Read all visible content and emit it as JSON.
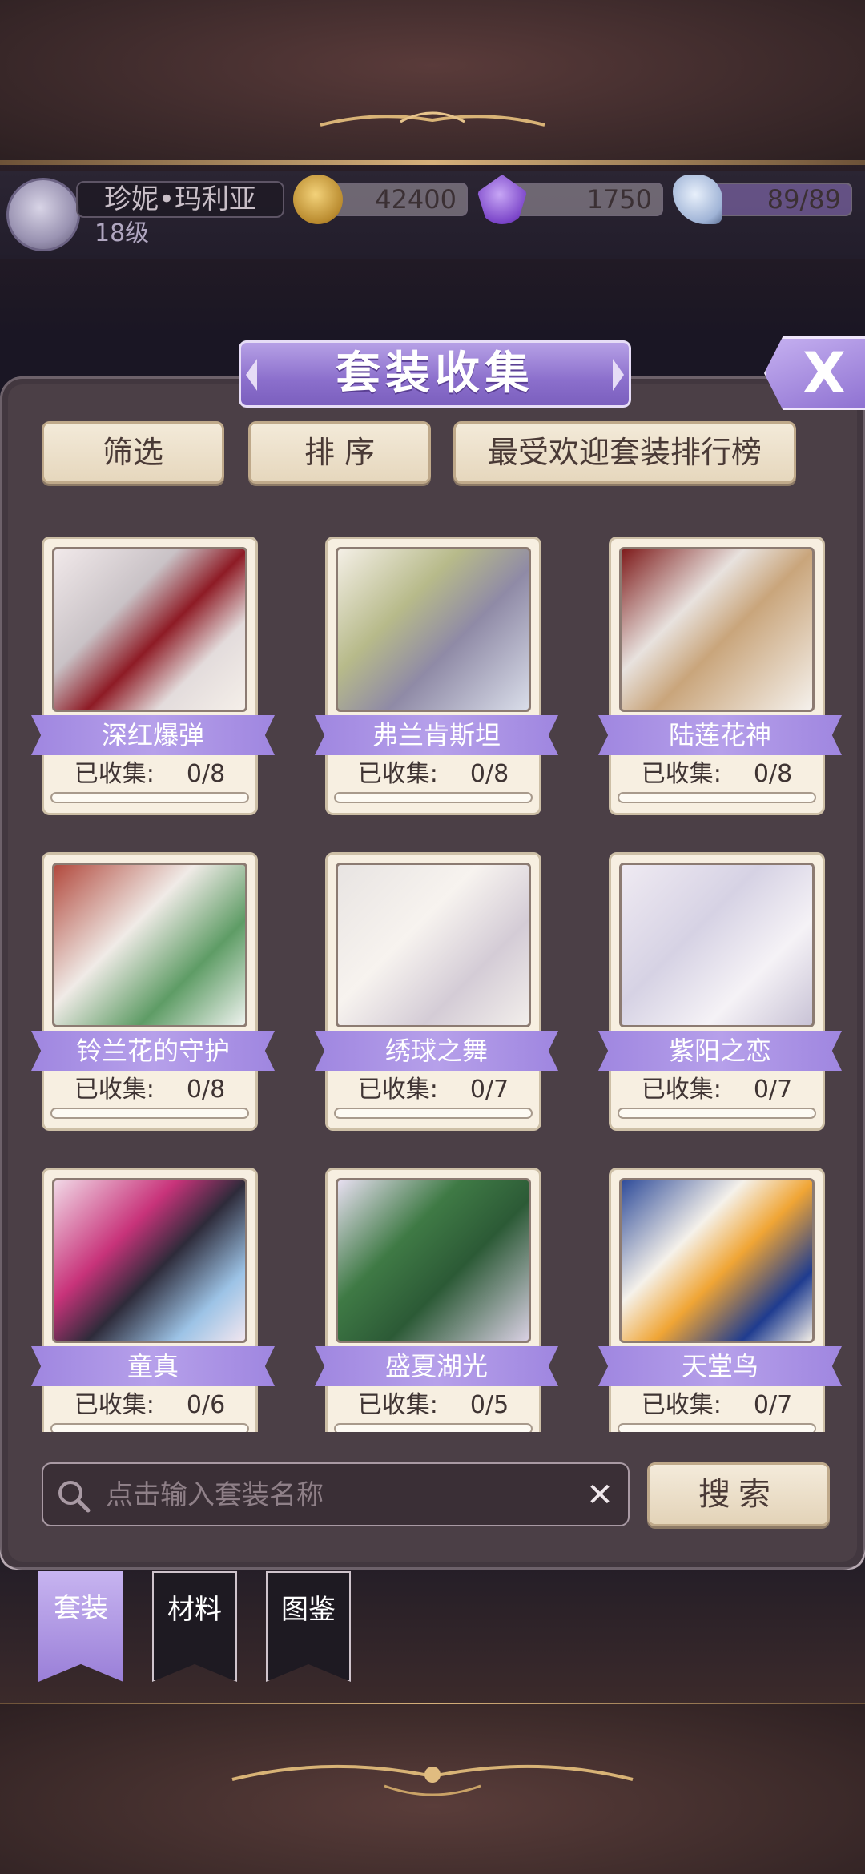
{
  "player": {
    "name": "珍妮•玛利亚",
    "level": "18级"
  },
  "resources": {
    "gold": "42400",
    "diamonds": "1750",
    "stamina": "89/89"
  },
  "panel": {
    "title": "套装收集",
    "close_label": "X"
  },
  "filters": {
    "filter_label": "筛选",
    "sort_label": "排 序",
    "ranking_label": "最受欢迎套装排行榜"
  },
  "progress_prefix": "已收集:",
  "outfits": [
    {
      "name": "深红爆弹",
      "progress": "0/8",
      "ratio": 0
    },
    {
      "name": "弗兰肯斯坦",
      "progress": "0/8",
      "ratio": 0
    },
    {
      "name": "陆莲花神",
      "progress": "0/8",
      "ratio": 0
    },
    {
      "name": "铃兰花的守护",
      "progress": "0/8",
      "ratio": 0
    },
    {
      "name": "绣球之舞",
      "progress": "0/7",
      "ratio": 0
    },
    {
      "name": "紫阳之恋",
      "progress": "0/7",
      "ratio": 0
    },
    {
      "name": "童真",
      "progress": "0/6",
      "ratio": 0
    },
    {
      "name": "盛夏湖光",
      "progress": "0/5",
      "ratio": 0
    },
    {
      "name": "天堂鸟",
      "progress": "0/7",
      "ratio": 0
    }
  ],
  "search": {
    "placeholder": "点击输入套装名称",
    "clear_label": "✕",
    "button_label": "搜索"
  },
  "tabs": [
    {
      "label": "套装",
      "active": true
    },
    {
      "label": "材料",
      "active": false
    },
    {
      "label": "图鉴",
      "active": false
    }
  ],
  "icons": {
    "gold": "crown-coin-icon",
    "diamond": "purple-gem-icon",
    "stamina": "glass-slipper-icon"
  },
  "colors": {
    "accent_purple": "#9f86e0",
    "card_bg": "#f7efe1",
    "panel_bg": "#4b3f46"
  }
}
